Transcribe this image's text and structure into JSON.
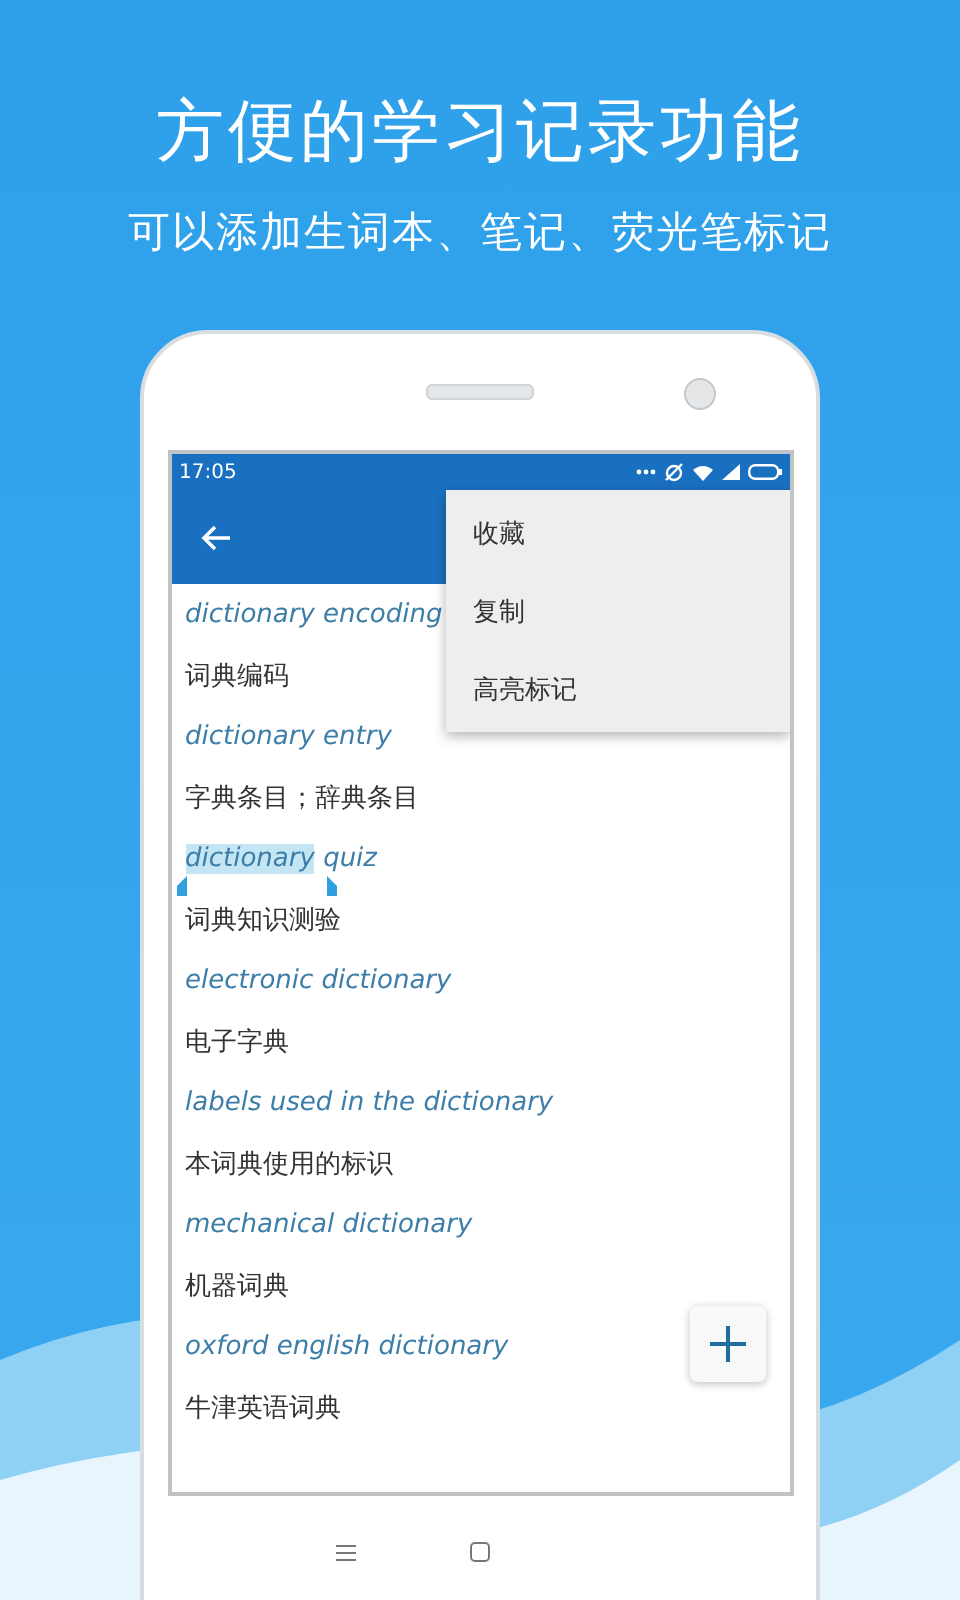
{
  "header": {
    "title": "方便的学习记录功能",
    "subtitle": "可以添加生词本、笔记、荧光笔标记"
  },
  "status_bar": {
    "time": "17:05"
  },
  "entries": [
    {
      "term": [
        {
          "text": "dictionary encoding",
          "selected": false
        }
      ],
      "translation": "词典编码"
    },
    {
      "term": [
        {
          "text": "dictionary entry",
          "selected": false
        }
      ],
      "translation": "字典条目；辞典条目"
    },
    {
      "term": [
        {
          "text": "dictionary",
          "selected": true
        },
        {
          "text": "quiz",
          "selected": false
        }
      ],
      "translation": "词典知识测验"
    },
    {
      "term": [
        {
          "text": "electronic dictionary",
          "selected": false
        }
      ],
      "translation": "电子字典"
    },
    {
      "term": [
        {
          "text": "labels used in the dictionary",
          "selected": false
        }
      ],
      "translation": "本词典使用的标识"
    },
    {
      "term": [
        {
          "text": "mechanical dictionary",
          "selected": false
        }
      ],
      "translation": "机器词典"
    },
    {
      "term": [
        {
          "text": "oxford english dictionary",
          "selected": false
        }
      ],
      "translation": "牛津英语词典"
    }
  ],
  "menu": {
    "items": [
      "收藏",
      "复制",
      "高亮标记"
    ]
  }
}
